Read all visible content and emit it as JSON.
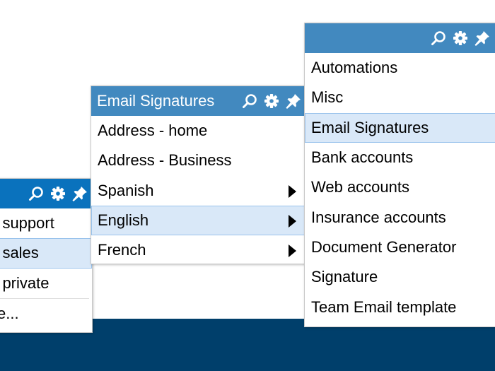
{
  "left_menu": {
    "title": "",
    "items": [
      {
        "label": "- support"
      },
      {
        "label": "- sales",
        "highlighted": true
      },
      {
        "label": "- private"
      },
      {
        "label": "e..."
      }
    ]
  },
  "middle_menu": {
    "title": "Email Signatures",
    "items": [
      {
        "label": "Address - home"
      },
      {
        "label": "Address - Business"
      },
      {
        "label": "Spanish",
        "submenu": true
      },
      {
        "label": "English",
        "submenu": true,
        "highlighted": true
      },
      {
        "label": "French",
        "submenu": true
      }
    ]
  },
  "right_menu": {
    "title": "",
    "items": [
      {
        "label": "Automations"
      },
      {
        "label": "Misc"
      },
      {
        "label": "Email Signatures",
        "highlighted": true
      },
      {
        "label": "Bank accounts"
      },
      {
        "label": "Web accounts"
      },
      {
        "label": "Insurance accounts"
      },
      {
        "label": "Document Generator"
      },
      {
        "label": "Signature"
      },
      {
        "label": "Team Email template"
      }
    ]
  },
  "icons": [
    "search-icon",
    "gear-icon",
    "pin-icon"
  ],
  "colors": {
    "header": "#4289bf",
    "left_header": "#0a72bd",
    "highlight": "#d9e8f8",
    "band": "#003f6b"
  }
}
